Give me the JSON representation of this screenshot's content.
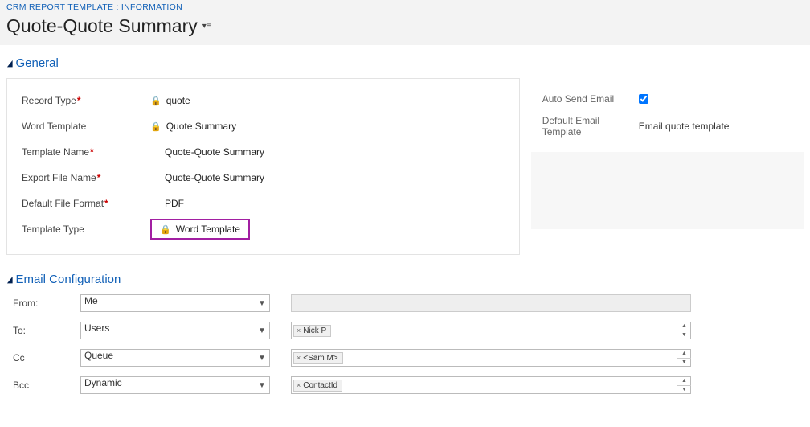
{
  "breadcrumb": "CRM REPORT TEMPLATE : INFORMATION",
  "title": "Quote-Quote Summary",
  "sections": {
    "general": "General",
    "email": "Email Configuration"
  },
  "general": {
    "fields": {
      "recordType": {
        "label": "Record Type",
        "value": "quote",
        "locked": true,
        "required": true
      },
      "wordTemplate": {
        "label": "Word Template",
        "value": "Quote Summary",
        "locked": true,
        "required": false
      },
      "templateName": {
        "label": "Template Name",
        "value": "Quote-Quote Summary",
        "locked": false,
        "required": true
      },
      "exportFileName": {
        "label": "Export File Name",
        "value": "Quote-Quote Summary",
        "locked": false,
        "required": true
      },
      "defaultFileFormat": {
        "label": "Default File Format",
        "value": "PDF",
        "locked": false,
        "required": true
      },
      "templateType": {
        "label": "Template Type",
        "value": "Word Template",
        "locked": true,
        "required": false,
        "highlight": true
      }
    },
    "right": {
      "autoSend": {
        "label": "Auto Send Email",
        "checked": true
      },
      "defaultEmailTemplate": {
        "label": "Default Email Template",
        "value": "Email quote template"
      }
    }
  },
  "email": {
    "from": {
      "label": "From:",
      "select": "Me",
      "tokens": [],
      "disabled": true
    },
    "to": {
      "label": "To:",
      "select": "Users",
      "tokens": [
        "Nick P"
      ]
    },
    "cc": {
      "label": "Cc",
      "select": "Queue",
      "tokens": [
        "<Sam M>"
      ]
    },
    "bcc": {
      "label": "Bcc",
      "select": "Dynamic",
      "tokens": [
        "ContactId"
      ]
    }
  }
}
